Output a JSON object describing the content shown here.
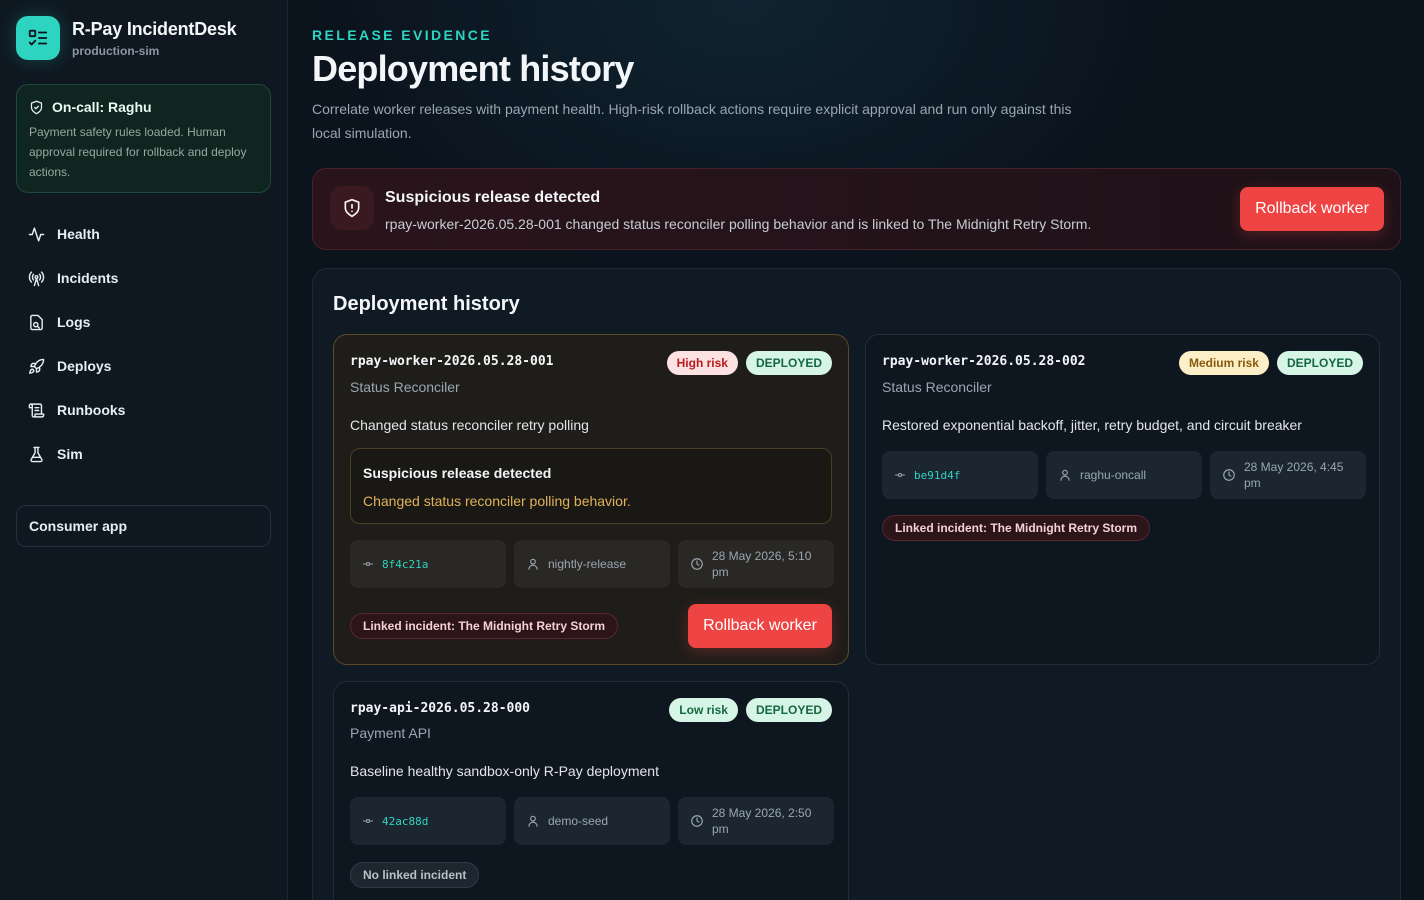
{
  "brand": {
    "title": "R-Pay IncidentDesk",
    "subtitle": "production-sim"
  },
  "oncall": {
    "title": "On-call: Raghu",
    "body": "Payment safety rules loaded. Human approval required for rollback and deploy actions."
  },
  "nav": [
    {
      "label": "Health",
      "icon": "pulse-icon"
    },
    {
      "label": "Incidents",
      "icon": "broadcast-icon"
    },
    {
      "label": "Logs",
      "icon": "logs-icon"
    },
    {
      "label": "Deploys",
      "icon": "rocket-icon"
    },
    {
      "label": "Runbooks",
      "icon": "scroll-icon"
    },
    {
      "label": "Sim",
      "icon": "flask-icon"
    }
  ],
  "consumer_app": "Consumer app",
  "header": {
    "eyebrow": "RELEASE EVIDENCE",
    "title": "Deployment history",
    "description": "Correlate worker releases with payment health. High-risk rollback actions require explicit approval and run only against this local simulation."
  },
  "alert": {
    "title": "Suspicious release detected",
    "text": "rpay-worker-2026.05.28-001 changed status reconciler polling behavior and is linked to The Midnight Retry Storm.",
    "action": "Rollback worker"
  },
  "panel": {
    "title": "Deployment history"
  },
  "deployments": [
    {
      "id": "rpay-worker-2026.05.28-001",
      "service": "Status Reconciler",
      "risk": "High risk",
      "status": "DEPLOYED",
      "description": "Changed status reconciler retry polling",
      "suspicious_title": "Suspicious release detected",
      "suspicious_text": "Changed status reconciler polling behavior.",
      "commit": "8f4c21a",
      "author": "nightly-release",
      "time": "28 May 2026, 5:10 pm",
      "linked": "Linked incident: The Midnight Retry Storm",
      "action": "Rollback worker"
    },
    {
      "id": "rpay-worker-2026.05.28-002",
      "service": "Status Reconciler",
      "risk": "Medium risk",
      "status": "DEPLOYED",
      "description": "Restored exponential backoff, jitter, retry budget, and circuit breaker",
      "commit": "be91d4f",
      "author": "raghu-oncall",
      "time": "28 May 2026, 4:45 pm",
      "linked": "Linked incident: The Midnight Retry Storm"
    },
    {
      "id": "rpay-api-2026.05.28-000",
      "service": "Payment API",
      "risk": "Low risk",
      "status": "DEPLOYED",
      "description": "Baseline healthy sandbox-only R-Pay deployment",
      "commit": "42ac88d",
      "author": "demo-seed",
      "time": "28 May 2026, 2:50 pm",
      "linked": "No linked incident"
    }
  ],
  "colors": {
    "accent": "#2dd4bf",
    "danger": "#ef4444",
    "background": "#0b131d"
  }
}
